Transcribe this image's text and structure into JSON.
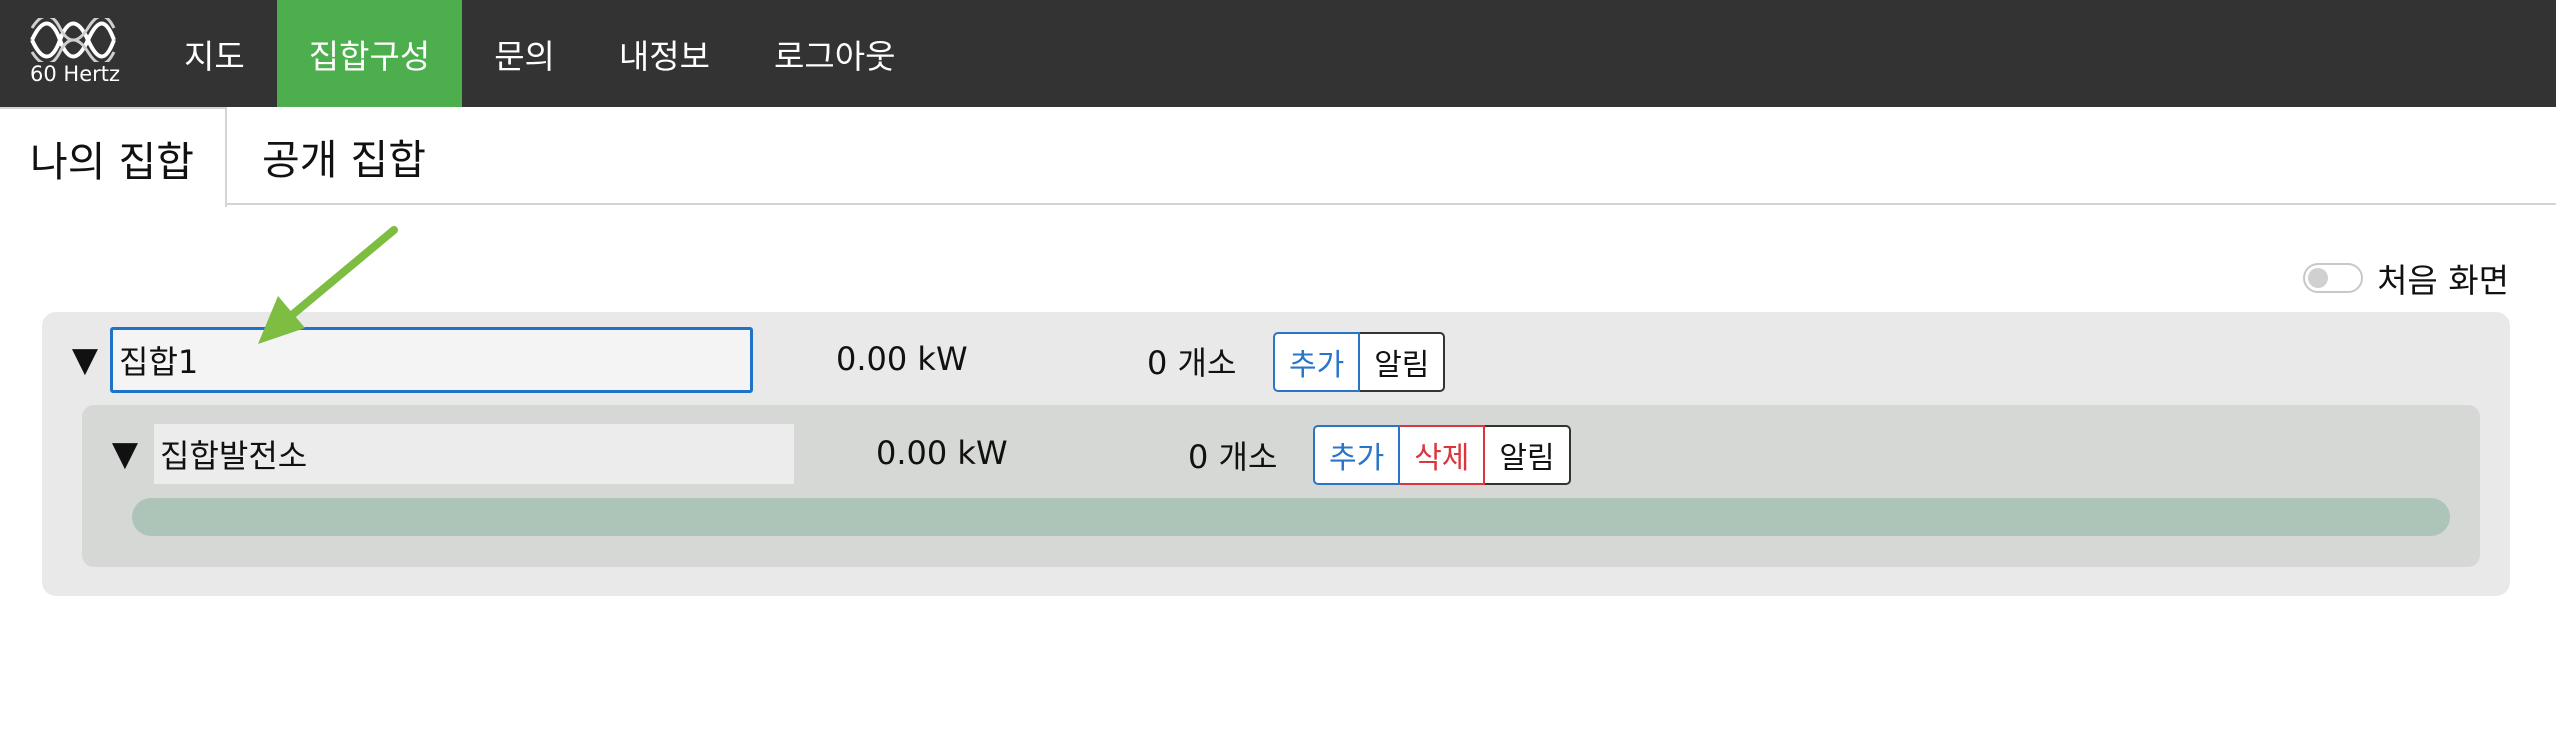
{
  "app": {
    "logo_text": "60 Hertz"
  },
  "nav": {
    "items": [
      {
        "label": "지도",
        "active": false
      },
      {
        "label": "집합구성",
        "active": true
      },
      {
        "label": "문의",
        "active": false
      },
      {
        "label": "내정보",
        "active": false
      },
      {
        "label": "로그아웃",
        "active": false
      }
    ]
  },
  "tabs": [
    {
      "label": "나의 집합",
      "active": true
    },
    {
      "label": "공개 집합",
      "active": false
    }
  ],
  "toggle": {
    "label": "처음 화면",
    "on": false
  },
  "group": {
    "name": "집합1",
    "power": "0.00 kW",
    "count": "0 개소",
    "buttons": {
      "add": "추가",
      "alert": "알림"
    },
    "child": {
      "name": "집합발전소",
      "power": "0.00 kW",
      "count": "0 개소",
      "buttons": {
        "add": "추가",
        "delete": "삭제",
        "alert": "알림"
      }
    }
  },
  "colors": {
    "nav_bg": "#333333",
    "nav_active": "#4cae4c",
    "add": "#2a74c9",
    "delete": "#d9363e",
    "arrow": "#7cbd42"
  },
  "icons": {
    "logo": "sine-wave-logo-icon",
    "caret": "triangle-down-icon",
    "annotation": "green-arrow-icon"
  }
}
